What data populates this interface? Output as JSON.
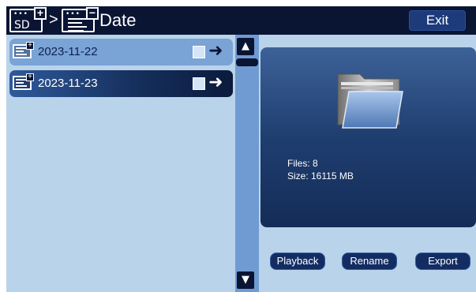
{
  "header": {
    "separator": ">",
    "title": "Date",
    "sd_icon_label": "SD",
    "exit_label": "Exit"
  },
  "list": {
    "items": [
      {
        "label": "2023-11-22",
        "selected": true
      },
      {
        "label": "2023-11-23",
        "selected": false
      }
    ]
  },
  "info": {
    "files": "Files: 8",
    "size": "Size: 16115 MB"
  },
  "actions": {
    "playback_label": "Playback",
    "rename_label": "Rename",
    "export_label": "Export"
  },
  "colors": {
    "header_bg": "#0a1534",
    "screen_bg": "#b9d3ea",
    "accent": "#1d3b7a",
    "selected_row": "#7aa3d6"
  }
}
